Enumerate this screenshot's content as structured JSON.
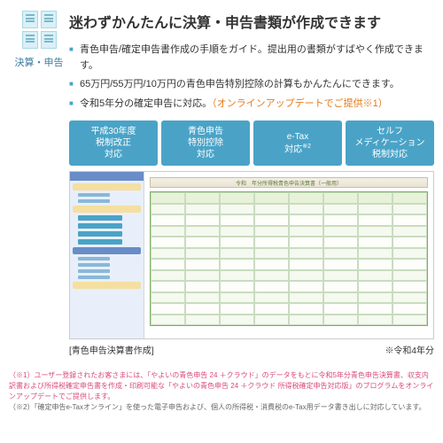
{
  "left": {
    "label": "決算・申告"
  },
  "heading": "迷わずかんたんに決算・申告書類が作成できます",
  "bullets": [
    {
      "text": "青色申告/確定申告書作成の手順をガイド。提出用の書類がすばやく作成できます。"
    },
    {
      "text": "65万円/55万円/10万円の青色申告特別控除の計算もかんたんにできます。"
    },
    {
      "text_pre": "令和5年分の確定申告に対応。",
      "text_orange": "（オンラインアップデートでご提供※1）"
    }
  ],
  "badges": [
    {
      "line1": "平成30年度",
      "line2": "税制改正",
      "line3": "対応"
    },
    {
      "line1": "青色申告",
      "line2": "特別控除",
      "line3": "対応"
    },
    {
      "line1": "e-Tax",
      "line2": "対応",
      "sup": "※2"
    },
    {
      "line1": "セルフ",
      "line2": "メディケーション",
      "line3": "税制対応"
    }
  ],
  "screenshot": {
    "doc_title": "令和　年分所得税青色申告決算書（一般用）"
  },
  "caption": {
    "left": "[青色申告決算書作成]",
    "right": "※令和4年分"
  },
  "footnotes": {
    "f1": "（※1）ユーザー登録されたお客さまには、「やよいの青色申告 24 ＋クラウド」のデータをもとに令和5年分青色申告決算書、収支内訳書および所得税確定申告書を作成・印刷可能な「やよいの青色申告 24 ＋クラウド 所得税確定申告対応版」のプログラムをオンラインアップデートでご提供します。",
    "f2": "（※2）「確定申告e-Taxオンライン」を使った電子申告および、個人の所得税・消費税のe-Tax用データ書き出しに対応しています。"
  }
}
